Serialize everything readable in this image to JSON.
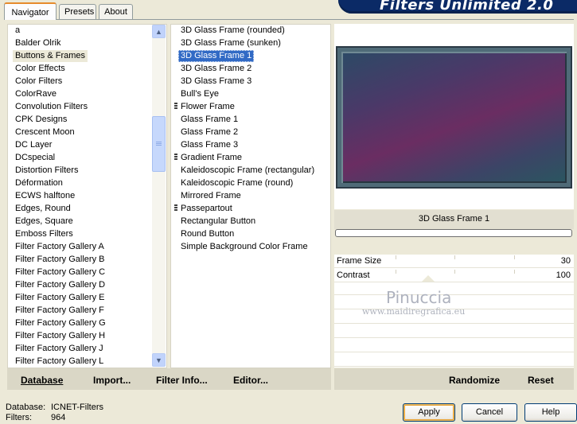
{
  "tabs": [
    {
      "label": "Navigator",
      "active": true
    },
    {
      "label": "Presets",
      "active": false
    },
    {
      "label": "About",
      "active": false
    }
  ],
  "banner": {
    "title": "Filters Unlimited 2.0"
  },
  "categories": {
    "items": [
      "a",
      "Balder Olrik",
      "Buttons & Frames",
      "Color Effects",
      "Color Filters",
      "ColorRave",
      "Convolution Filters",
      "CPK Designs",
      "Crescent Moon",
      "DC Layer",
      "DCspecial",
      "Distortion Filters",
      "Déformation",
      "ECWS halftone",
      "Edges, Round",
      "Edges, Square",
      "Emboss Filters",
      "Filter Factory Gallery A",
      "Filter Factory Gallery B",
      "Filter Factory Gallery C",
      "Filter Factory Gallery D",
      "Filter Factory Gallery E",
      "Filter Factory Gallery F",
      "Filter Factory Gallery G",
      "Filter Factory Gallery H",
      "Filter Factory Gallery J",
      "Filter Factory Gallery L"
    ],
    "selected": "Buttons & Frames"
  },
  "filters": {
    "items": [
      {
        "label": "3D Glass Frame (rounded)",
        "group": false
      },
      {
        "label": "3D Glass Frame (sunken)",
        "group": false
      },
      {
        "label": "3D Glass Frame 1",
        "group": false
      },
      {
        "label": "3D Glass Frame 2",
        "group": false
      },
      {
        "label": "3D Glass Frame 3",
        "group": false
      },
      {
        "label": "Bull's Eye",
        "group": false
      },
      {
        "label": "Flower Frame",
        "group": true
      },
      {
        "label": "Glass Frame 1",
        "group": false
      },
      {
        "label": "Glass Frame 2",
        "group": false
      },
      {
        "label": "Glass Frame 3",
        "group": false
      },
      {
        "label": "Gradient Frame",
        "group": true
      },
      {
        "label": "Kaleidoscopic Frame (rectangular)",
        "group": false
      },
      {
        "label": "Kaleidoscopic Frame (round)",
        "group": false
      },
      {
        "label": "Mirrored Frame",
        "group": false
      },
      {
        "label": "Passepartout",
        "group": true
      },
      {
        "label": "Rectangular Button",
        "group": false
      },
      {
        "label": "Round Button",
        "group": false
      },
      {
        "label": "Simple Background Color Frame",
        "group": false
      }
    ],
    "selected": "3D Glass Frame 1"
  },
  "preview": {
    "filter_name": "3D Glass Frame 1"
  },
  "params": [
    {
      "label": "Frame Size",
      "value": "30"
    },
    {
      "label": "Contrast",
      "value": "100"
    }
  ],
  "watermark": {
    "name": "Pinuccia",
    "url": "www.maidiregrafica.eu"
  },
  "left_bar": {
    "database": "Database",
    "import": "Import...",
    "filter_info": "Filter Info...",
    "editor": "Editor..."
  },
  "right_bar": {
    "randomize": "Randomize",
    "reset": "Reset"
  },
  "status": {
    "database_label": "Database:",
    "database_value": "ICNET-Filters",
    "filters_label": "Filters:",
    "filters_value": "964"
  },
  "buttons": {
    "apply": "Apply",
    "cancel": "Cancel",
    "help": "Help"
  },
  "colors": {
    "selection": "#316AC5",
    "banner": "#0B2A66",
    "tab_accent": "#E68B2C"
  }
}
